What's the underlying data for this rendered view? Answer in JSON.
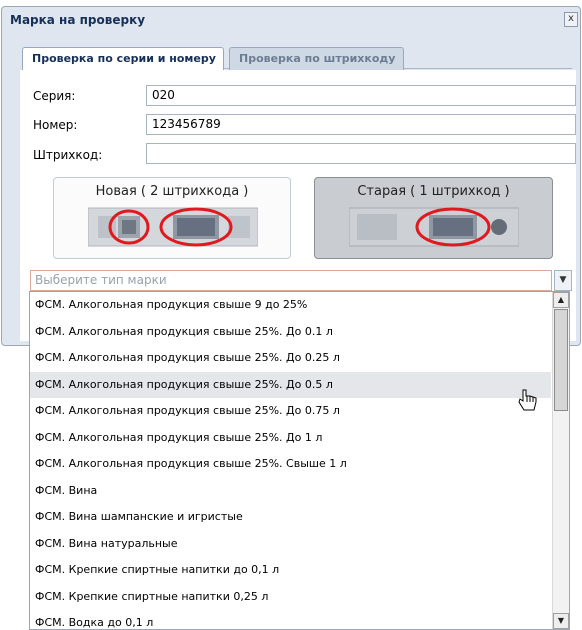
{
  "dialog": {
    "title": "Марка на проверку",
    "close_label": "x",
    "tabs": [
      {
        "label": "Проверка по серии и номеру",
        "active": true
      },
      {
        "label": "Проверка по штрихкоду",
        "active": false
      }
    ],
    "fields": {
      "series": {
        "label": "Серия:",
        "value": "020"
      },
      "number": {
        "label": "Номер:",
        "value": "123456789"
      },
      "barcode": {
        "label": "Штрихкод:",
        "value": ""
      }
    },
    "mark_types": {
      "new": {
        "label": "Новая ( 2 штрихкода )"
      },
      "old": {
        "label": "Старая ( 1 штрихкод )",
        "selected": true
      }
    },
    "combo": {
      "placeholder": "Выберите тип марки",
      "trigger_icon": "chevron-down-icon"
    }
  },
  "dropdown": {
    "items": [
      "ФСМ. Алкогольная продукция свыше 9 до 25%",
      "ФСМ. Алкогольная продукция свыше 25%. До 0.1 л",
      "ФСМ. Алкогольная продукция свыше 25%. До 0.25 л",
      "ФСМ. Алкогольная продукция свыше 25%. До 0.5 л",
      "ФСМ. Алкогольная продукция свыше 25%. До 0.75 л",
      "ФСМ. Алкогольная продукция свыше 25%. До 1 л",
      "ФСМ. Алкогольная продукция свыше 25%. Свыше 1 л",
      "ФСМ. Вина",
      "ФСМ. Вина шампанские и игристые",
      "ФСМ. Вина натуральные",
      "ФСМ. Крепкие спиртные напитки до 0,1 л",
      "ФСМ. Крепкие спиртные напитки 0,25 л",
      "ФСМ. Водка до 0,1 л"
    ],
    "hovered_index": 3
  },
  "colors": {
    "window_bg": "#dfe6ef",
    "title_text": "#15315a",
    "highlight_ring": "#e0191e",
    "hover_row": "#e4e6ea"
  }
}
